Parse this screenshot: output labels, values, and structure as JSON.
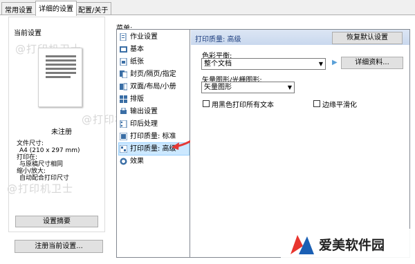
{
  "tabs": [
    {
      "label": "常用设置"
    },
    {
      "label": "详细的设置"
    },
    {
      "label": "配置/关于"
    }
  ],
  "current_settings": {
    "group_title": "当前设置",
    "preview_caption": "未注册",
    "page_size_label": "文件尺寸:",
    "page_size_value": "A4 (210 x 297 mm)",
    "print_on_label": "打印在:",
    "print_on_value": "与原稿尺寸相同",
    "zoom_label": "缩小/放大:",
    "zoom_value": "自动配合打印尺寸",
    "summary_button": "设置摘要",
    "register_button": "注册当前设置..."
  },
  "menu": {
    "label": "菜单:",
    "items": [
      {
        "label": "作业设置"
      },
      {
        "label": "基本"
      },
      {
        "label": "纸张"
      },
      {
        "label": "封页/隔页/指定"
      },
      {
        "label": "双面/布局/小册"
      },
      {
        "label": "排版"
      },
      {
        "label": "输出设置"
      },
      {
        "label": "印后处理"
      },
      {
        "label": "打印质量: 标准"
      },
      {
        "label": "打印质量: 高级"
      },
      {
        "label": "效果"
      }
    ],
    "selected_index": 9
  },
  "panel": {
    "title": "打印质量: 高级",
    "reset_button": "恢复默认设置",
    "color_balance_label": "色彩平衡:",
    "color_balance_value": "整个文档",
    "details_button": "详细资料...",
    "vector_label": "矢量图形/光栅图形:",
    "vector_value": "矢量图形",
    "black_text_label": "用黑色打印所有文本",
    "black_text_checked": false,
    "edge_smoothing_label": "边缘平滑化",
    "edge_smoothing_checked": false
  },
  "watermark": {
    "text": "@打印机卫士"
  },
  "logo": {
    "text": "爱美软件园"
  },
  "colors": {
    "selection": "#cce8ff",
    "header_gradient_top": "#dce6f4",
    "logo_red": "#e8352e",
    "logo_blue": "#1a5fb4"
  }
}
